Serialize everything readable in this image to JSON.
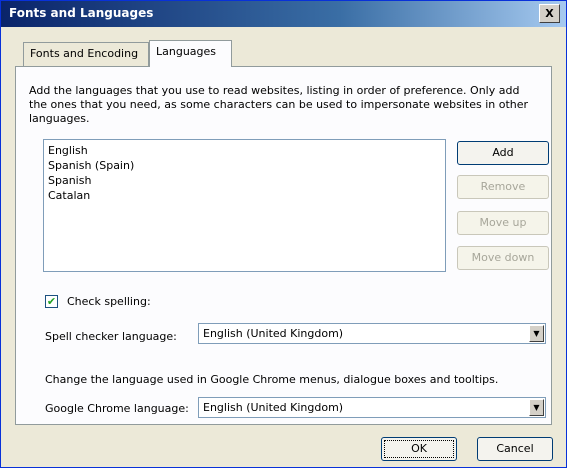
{
  "window": {
    "title": "Fonts and Languages",
    "close_label": "X"
  },
  "tabs": [
    {
      "label": "Fonts and Encoding",
      "active": false
    },
    {
      "label": "Languages",
      "active": true
    }
  ],
  "languages": {
    "description": "Add the languages that you use to read websites, listing in order of preference. Only add the ones that you need, as some characters can be used to impersonate websites in other languages.",
    "items": [
      "English",
      "Spanish (Spain)",
      "Spanish",
      "Catalan"
    ],
    "buttons": {
      "add": "Add",
      "remove": "Remove",
      "move_up": "Move up",
      "move_down": "Move down"
    }
  },
  "spell": {
    "checkbox_label": "Check spelling:",
    "checked": true,
    "checker_label": "Spell checker language:",
    "checker_value": "English (United Kingdom)"
  },
  "ui_language": {
    "description": "Change the language used in Google Chrome menus, dialogue boxes and tooltips.",
    "label": "Google Chrome language:",
    "value": "English (United Kingdom)"
  },
  "footer": {
    "ok": "OK",
    "cancel": "Cancel"
  }
}
